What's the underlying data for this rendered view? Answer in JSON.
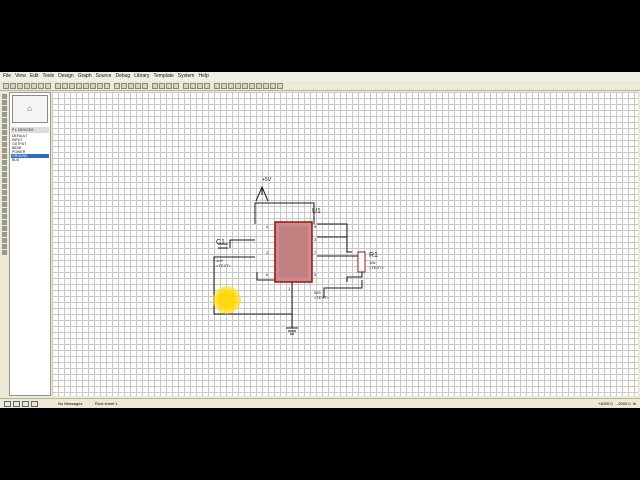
{
  "menu": [
    "File",
    "View",
    "Edit",
    "Tools",
    "Design",
    "Graph",
    "Source",
    "Debug",
    "Library",
    "Template",
    "System",
    "Help"
  ],
  "panel": {
    "tab_label": "P  L  DEVICES",
    "devices": [
      "DEFAULT",
      "INPUT",
      "OUTPUT",
      "BIDIR",
      "POWER",
      "GROUND",
      "BUS"
    ],
    "selected_index": 5
  },
  "schematic": {
    "u1_label": "U1",
    "c1_label": "C1",
    "c1_value": "1nF",
    "c1_text": "<TEXT>",
    "r1_label": "R1",
    "r1_value": "10k",
    "r1_text": "<TEXT>",
    "u1_text": "<TEXT>",
    "u1_part": "555",
    "power_label": "+5V",
    "pin_labels": [
      "4",
      "8",
      "3",
      "7",
      "2",
      "6",
      "1",
      "5"
    ]
  },
  "status": {
    "messages": "No Messages",
    "sheet": "Root sheet 1",
    "coord_x": "+4000.0",
    "coord_y": "-2000.0",
    "unit": "th"
  },
  "colors": {
    "wire": "#1a1a1a",
    "ic_body": "#cf8a8a",
    "ic_border": "#a01010",
    "grid": "#c8c8c8",
    "highlight": "#ffd700"
  }
}
